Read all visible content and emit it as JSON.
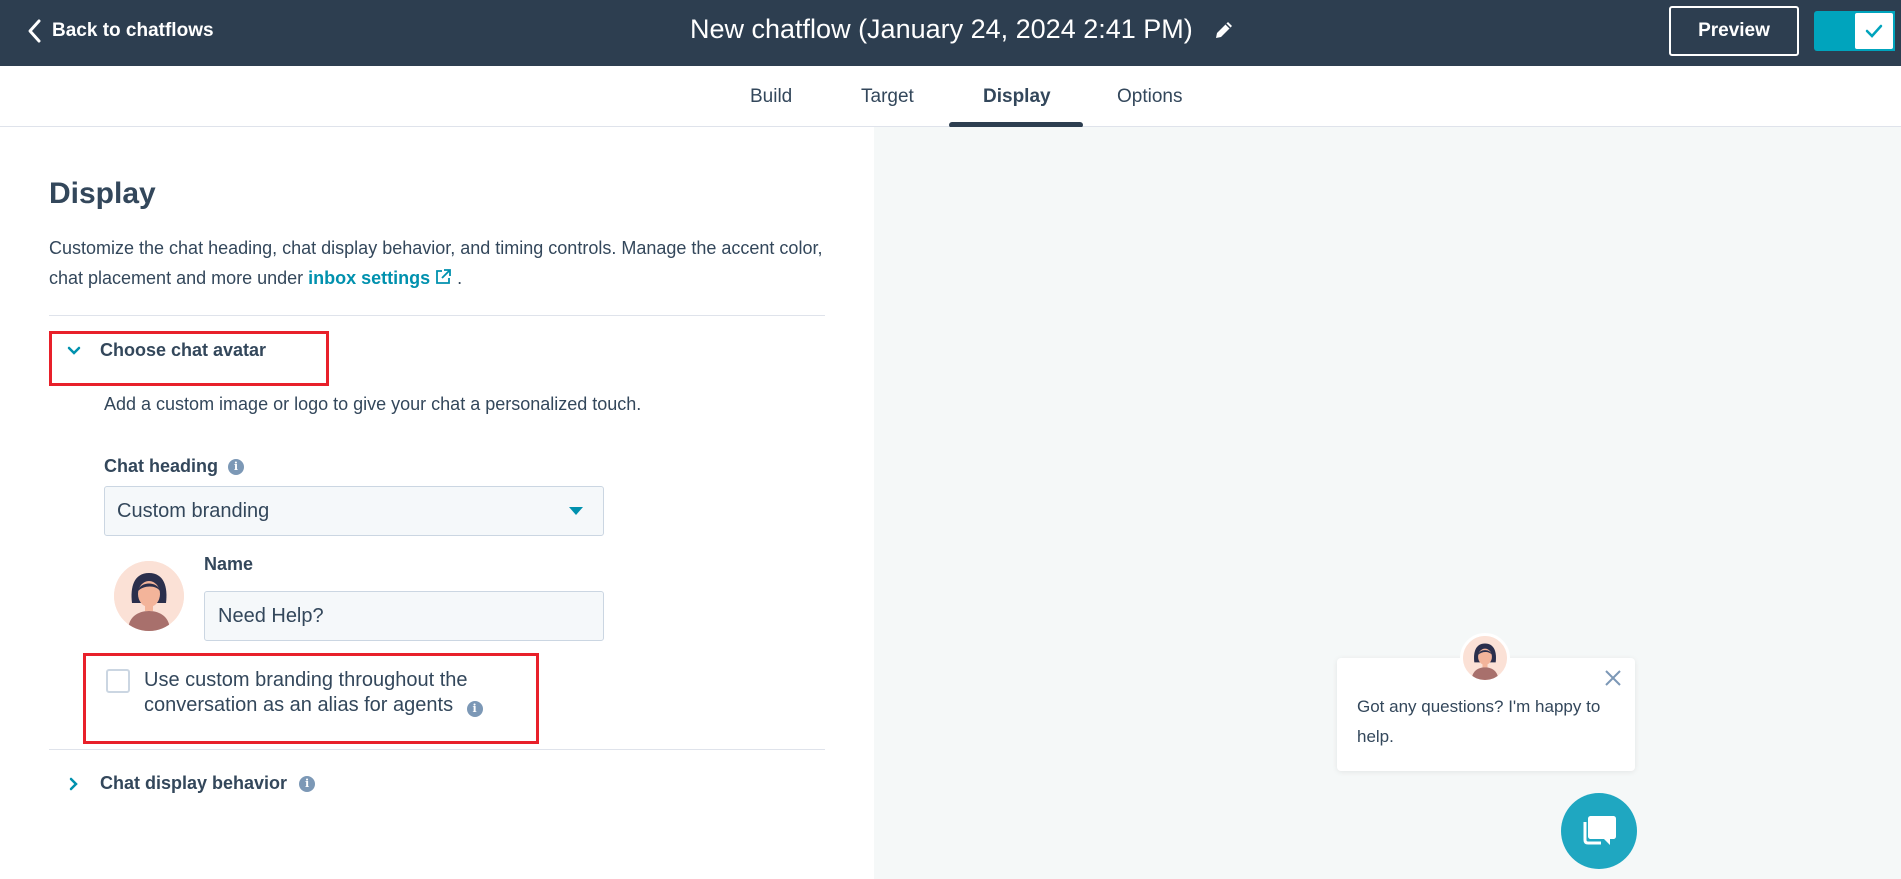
{
  "header": {
    "back_label": "Back to chatflows",
    "title": "New chatflow (January 24, 2024 2:41 PM)",
    "preview_label": "Preview"
  },
  "tabs": [
    {
      "label": "Build",
      "active": false
    },
    {
      "label": "Target",
      "active": false
    },
    {
      "label": "Display",
      "active": true
    },
    {
      "label": "Options",
      "active": false
    }
  ],
  "display": {
    "title": "Display",
    "description_before": "Customize the chat heading, chat display behavior, and timing controls. Manage the accent color, chat placement and more under ",
    "link_label": "inbox settings",
    "description_after": " ."
  },
  "avatar_section": {
    "header": "Choose chat avatar",
    "description": "Add a custom image or logo to give your chat a personalized touch.",
    "chat_heading_label": "Chat heading",
    "chat_heading_value": "Custom branding",
    "name_label": "Name",
    "name_value": "Need Help?",
    "checkbox_label": "Use custom branding throughout the conversation as an alias for agents",
    "checkbox_checked": false
  },
  "behavior_section": {
    "header": "Chat display behavior"
  },
  "chat_preview": {
    "message": "Got any questions? I'm happy to help."
  },
  "colors": {
    "header_bg": "#2d3e50",
    "accent": "#00a4bd",
    "link": "#0091ae",
    "highlight": "#e8202a",
    "preview_bg": "#f5f8f8"
  }
}
